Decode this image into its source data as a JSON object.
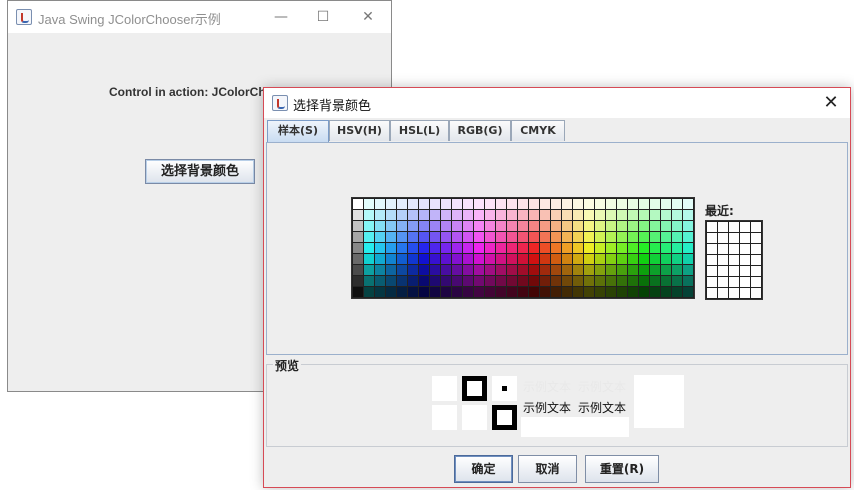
{
  "main_window": {
    "title": "Java Swing JColorChooser示例",
    "label": "Control in action: JColorChooser",
    "button_label": "选择背景颜色",
    "controls": {
      "minimize": "—",
      "maximize": "☐",
      "close": "✕"
    }
  },
  "dialog": {
    "title": "选择背景颜色",
    "close": "✕",
    "tabs": [
      {
        "label": "样本(S)",
        "active": true
      },
      {
        "label": "HSV(H)",
        "active": false
      },
      {
        "label": "HSL(L)",
        "active": false
      },
      {
        "label": "RGB(G)",
        "active": false
      },
      {
        "label": "CMYK",
        "active": false
      }
    ],
    "recent_label": "最近:",
    "preview": {
      "title": "预览",
      "sample_text": "示例文本",
      "sample_text_2": "示例文本"
    },
    "buttons": {
      "ok": "确定",
      "cancel": "取消",
      "reset": "重置(R)"
    }
  },
  "colors": {
    "accent_border": "#d64a55",
    "tab_active": "#c9dcf2"
  }
}
